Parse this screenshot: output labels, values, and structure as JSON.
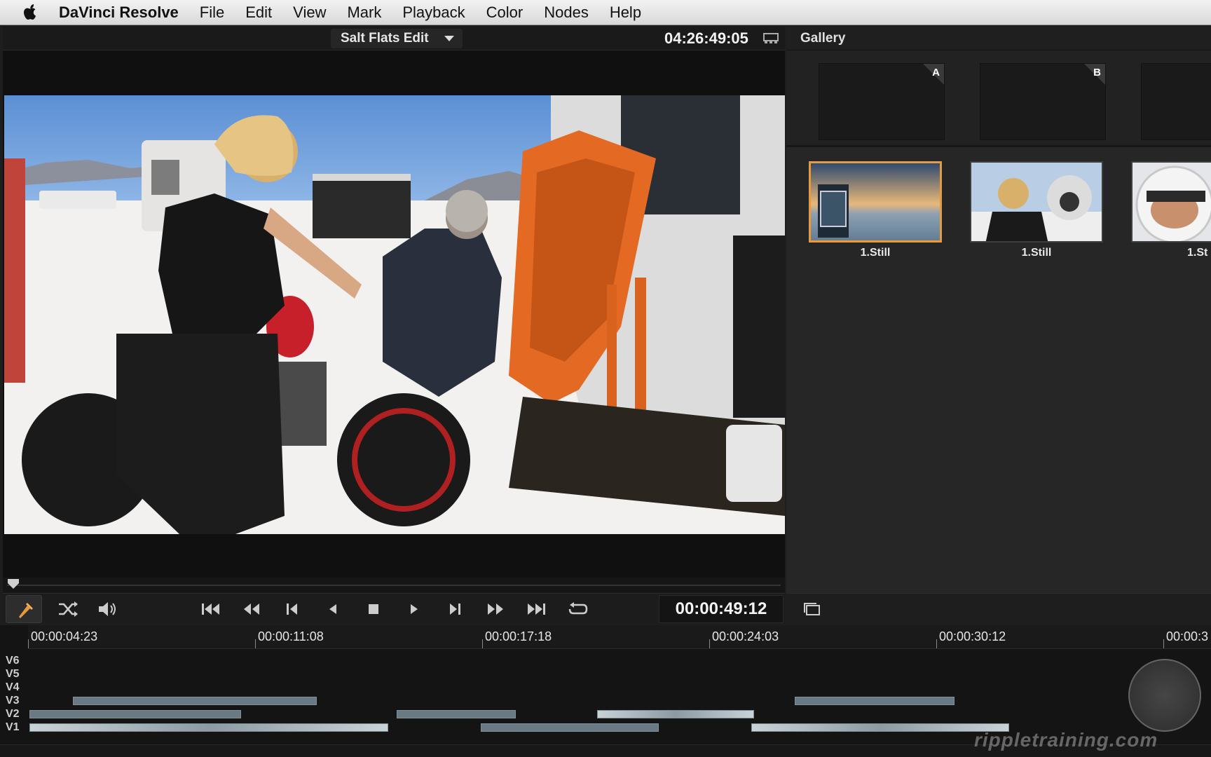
{
  "menubar": {
    "app_name": "DaVinci Resolve",
    "items": [
      "File",
      "Edit",
      "View",
      "Mark",
      "Playback",
      "Color",
      "Nodes",
      "Help"
    ]
  },
  "viewer": {
    "clip_name": "Salt Flats Edit",
    "source_timecode": "04:26:49:05",
    "record_timecode": "00:00:49:12",
    "icons": {
      "tool": "eyedropper-icon",
      "shuffle": "shuffle-icon",
      "audio": "speaker-icon",
      "first": "skip-to-start-icon",
      "rewind": "rewind-icon",
      "prev": "prev-frame-icon",
      "reverse": "play-reverse-icon",
      "stop": "stop-icon",
      "play": "play-icon",
      "next": "next-frame-icon",
      "ffwd": "fast-forward-icon",
      "last": "skip-to-end-icon",
      "loop": "loop-icon"
    }
  },
  "gallery": {
    "title": "Gallery",
    "memories": [
      "A",
      "B",
      ""
    ],
    "stills": [
      {
        "label": "1.Still",
        "selected": true
      },
      {
        "label": "1.Still",
        "selected": false
      },
      {
        "label": "1.St",
        "selected": false
      }
    ]
  },
  "timeline": {
    "ruler": [
      "00:00:04:23",
      "00:00:11:08",
      "00:00:17:18",
      "00:00:24:03",
      "00:00:30:12",
      "00:00:3"
    ],
    "tracks": [
      "V6",
      "V5",
      "V4",
      "V3",
      "V2",
      "V1"
    ],
    "watermark": "rippletraining.com",
    "accent": "#e89a3c"
  }
}
